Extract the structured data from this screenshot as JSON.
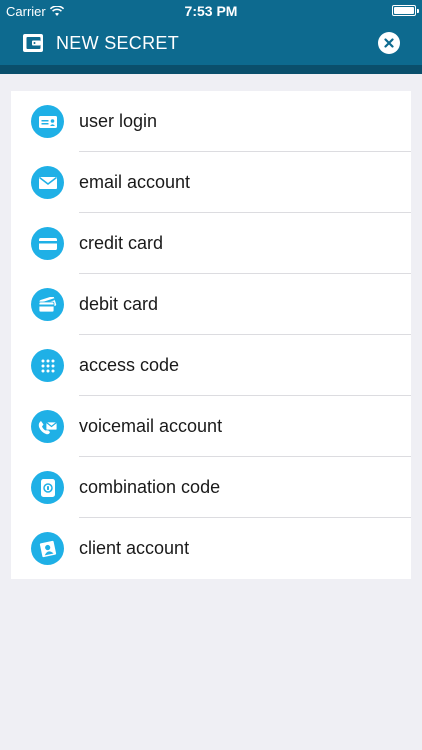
{
  "status_bar": {
    "carrier": "Carrier",
    "time": "7:53 PM"
  },
  "nav": {
    "title": "NEW SECRET",
    "wallet_icon": "wallet-icon",
    "close_icon": "close-icon"
  },
  "colors": {
    "header": "#0d6a8f",
    "header_shadow": "#0a4f6c",
    "accent": "#1fb0e6",
    "background": "#efeff4"
  },
  "items": [
    {
      "label": "user login",
      "icon": "id-card-icon"
    },
    {
      "label": "email account",
      "icon": "envelope-icon"
    },
    {
      "label": "credit card",
      "icon": "credit-card-icon"
    },
    {
      "label": "debit card",
      "icon": "debit-card-icon"
    },
    {
      "label": "access code",
      "icon": "keypad-icon"
    },
    {
      "label": "voicemail account",
      "icon": "voicemail-icon"
    },
    {
      "label": "combination code",
      "icon": "combination-lock-icon"
    },
    {
      "label": "client account",
      "icon": "client-icon"
    }
  ]
}
